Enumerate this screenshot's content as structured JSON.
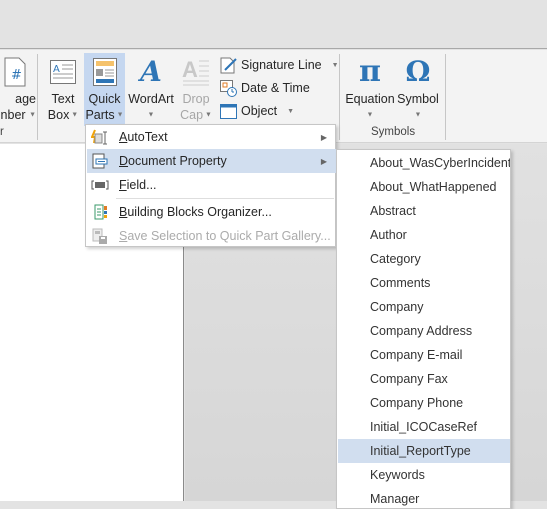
{
  "ribbon": {
    "page_number": {
      "line1": "age",
      "line2": "nber",
      "has_dropdown": true
    },
    "header_footer_group_label": "r",
    "text_box": {
      "line1": "Text",
      "line2": "Box"
    },
    "quick_parts": {
      "line1": "Quick",
      "line2": "Parts",
      "active": true
    },
    "wordart": {
      "label": "WordArt"
    },
    "drop_cap": {
      "line1": "Drop",
      "line2": "Cap",
      "disabled": true
    },
    "signature_line": {
      "label": "Signature Line"
    },
    "date_time": {
      "label": "Date & Time"
    },
    "object": {
      "label": "Object"
    },
    "equation": {
      "label": "Equation",
      "glyph": "π"
    },
    "symbol": {
      "label": "Symbol",
      "glyph": "Ω"
    },
    "symbols_group_label": "Symbols"
  },
  "quick_parts_menu": {
    "items": [
      {
        "label": "AutoText",
        "accel": "A",
        "rest": "utoText",
        "icon": "autotext-icon",
        "has_submenu": true
      },
      {
        "label": "Document Property",
        "accel": "D",
        "rest": "ocument Property",
        "icon": "document-property-icon",
        "has_submenu": true,
        "highlighted": true
      },
      {
        "label": "Field...",
        "accel": "F",
        "rest": "ield...",
        "icon": "field-icon"
      },
      {
        "label": "Building Blocks Organizer...",
        "accel": "B",
        "rest": "uilding Blocks Organizer...",
        "icon": "building-blocks-icon"
      },
      {
        "label": "Save Selection to Quick Part Gallery...",
        "accel": "S",
        "rest": "ave Selection to Quick Part Gallery...",
        "icon": "save-selection-icon",
        "disabled": true
      }
    ]
  },
  "document_property_submenu": {
    "items": [
      "About_WasCyberIncident",
      "About_WhatHappened",
      "Abstract",
      "Author",
      "Category",
      "Comments",
      "Company",
      "Company Address",
      "Company E-mail",
      "Company Fax",
      "Company Phone",
      "Initial_ICOCaseRef",
      "Initial_ReportType",
      "Keywords",
      "Manager"
    ],
    "highlighted": "Initial_ReportType"
  },
  "colors": {
    "accent_blue": "#2e75b6",
    "highlight": "#d1deef",
    "active_button": "#c5d7f0"
  }
}
